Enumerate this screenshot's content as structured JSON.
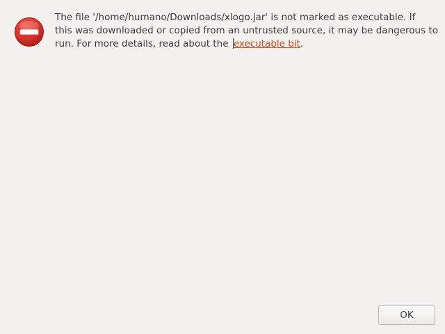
{
  "dialog": {
    "icon": "error-icon",
    "message": {
      "line1": "The file '/home/humano/Downloads/xlogo.jar' is not marked as executable.  If",
      "line2": "this was downloaded or copied from an untrusted source, it may be dangerous to",
      "line3_prefix": "run.  For more details, read about the ",
      "link_text": "executable bit",
      "line3_suffix": "."
    },
    "ok_label": "OK"
  },
  "colors": {
    "background": "#f2f1f0",
    "text": "#3c3c3c",
    "link": "#dd4814",
    "icon_red": "#d9302a"
  }
}
